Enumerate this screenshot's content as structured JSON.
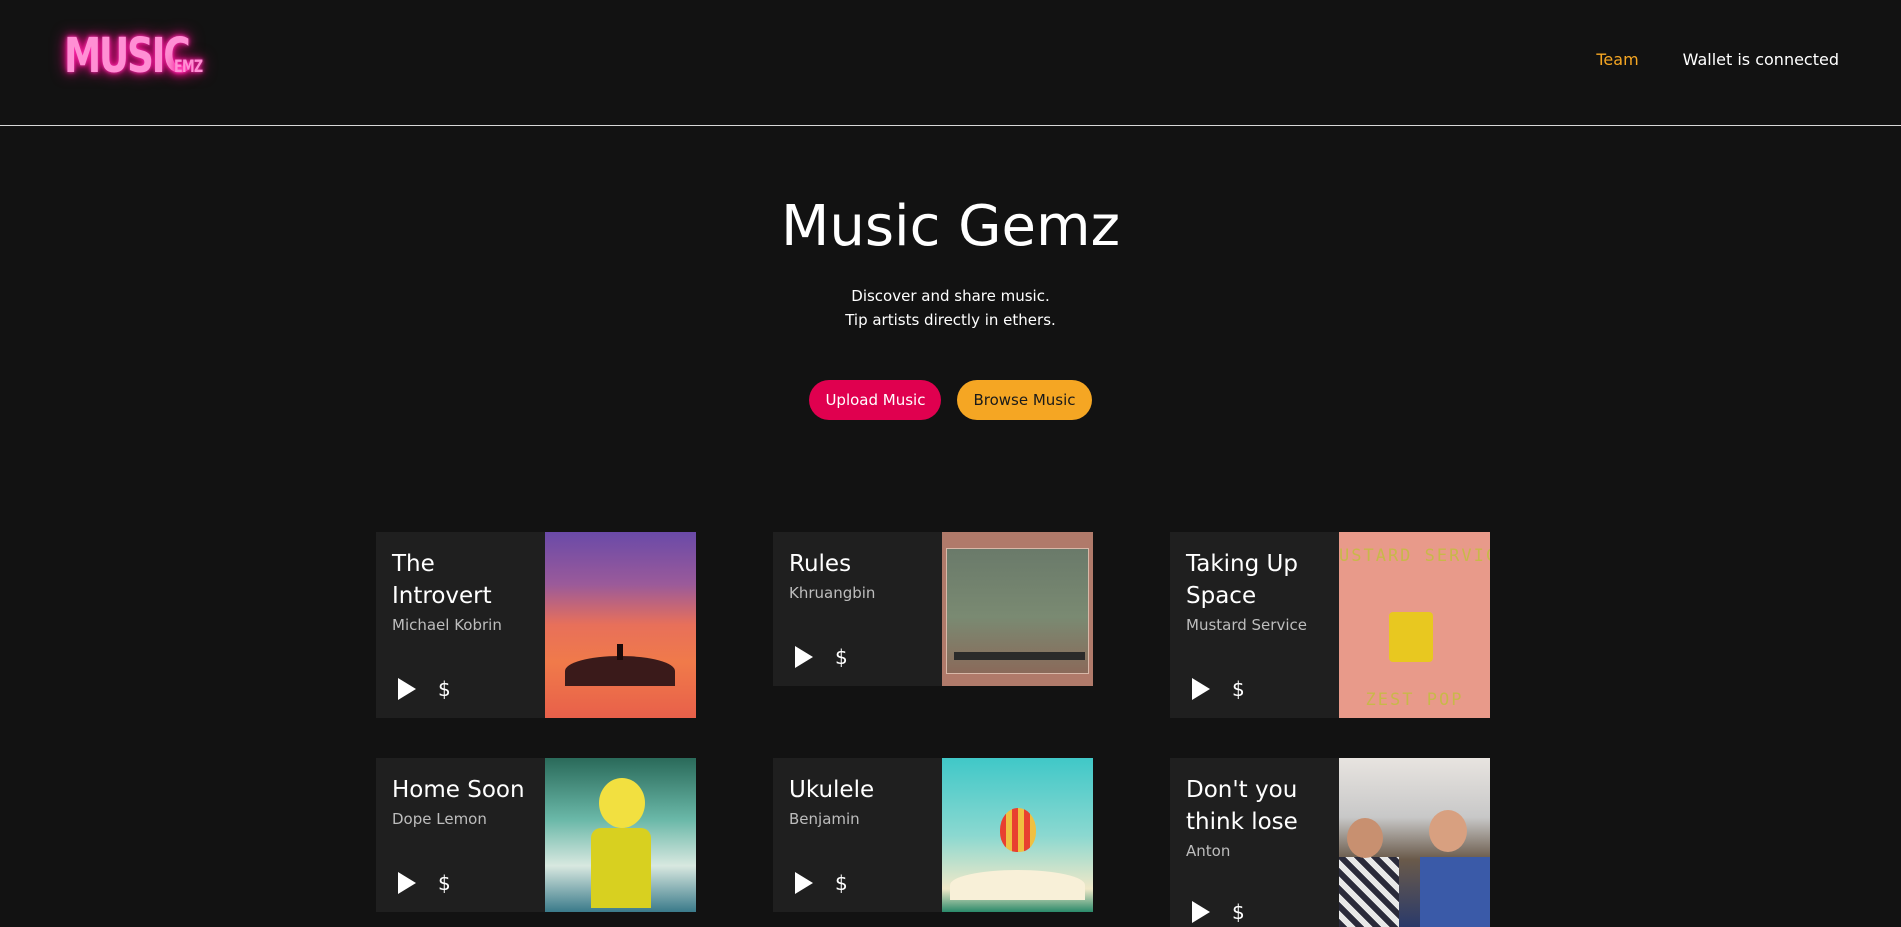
{
  "header": {
    "logo_main": "MUSIC",
    "logo_sub": "EMZ",
    "nav_team": "Team",
    "nav_wallet": "Wallet is connected"
  },
  "hero": {
    "title": "Music Gemz",
    "line1": "Discover and share music.",
    "line2": "Tip artists directly in ethers.",
    "upload_label": "Upload Music",
    "browse_label": "Browse Music"
  },
  "colors": {
    "background": "#121212",
    "card": "#1f1f1f",
    "accent_orange": "#f5a623",
    "accent_pink": "#e0004f",
    "logo_neon": "#ff1493"
  },
  "icons": {
    "play": "play-icon",
    "tip": "dollar-icon"
  },
  "cards": [
    {
      "title": "The Introvert",
      "artist": "Michael Kobrin",
      "tip_symbol": "$"
    },
    {
      "title": "Rules",
      "artist": "Khruangbin",
      "tip_symbol": "$"
    },
    {
      "title": "Taking Up Space",
      "artist": "Mustard Service",
      "tip_symbol": "$",
      "art_text_top": "USTARD SERVIC",
      "art_text_bottom": "ZEST POP"
    },
    {
      "title": "Home Soon",
      "artist": "Dope Lemon",
      "tip_symbol": "$"
    },
    {
      "title": "Ukulele",
      "artist": "Benjamin",
      "tip_symbol": "$"
    },
    {
      "title": "Don't you think lose",
      "artist": "Anton",
      "tip_symbol": "$"
    }
  ]
}
